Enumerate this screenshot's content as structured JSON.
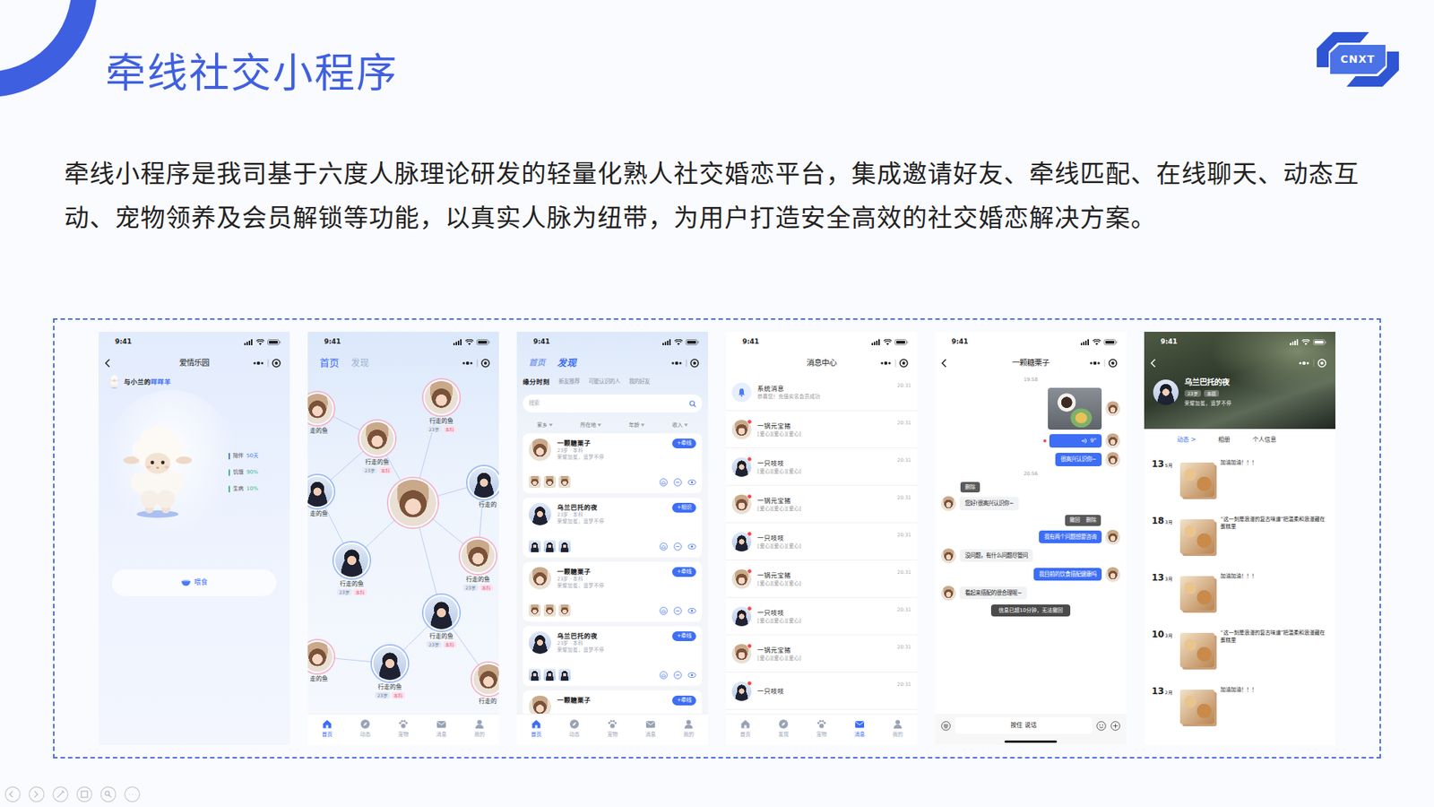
{
  "slide": {
    "title": "牵线社交小程序",
    "description": "牵线小程序是我司基于六度人脉理论研发的轻量化熟人社交婚恋平台，集成邀请好友、牵线匹配、在线聊天、动态互动、宠物领养及会员解锁等功能，以真实人脉为纽带，为用户打造安全高效的社交婚恋解决方案。",
    "logo": "CNXT"
  },
  "pet_screen": {
    "time": "9:41",
    "title": "爱情乐园",
    "owner_prefix": "与小兰的",
    "pet_name": "咩咩羊",
    "stats": [
      {
        "label": "陪伴",
        "value": "50天",
        "color": "#4a7bf0"
      },
      {
        "label": "饥饿",
        "value": "90%",
        "color": "#35b5a2"
      },
      {
        "label": "生病",
        "value": "10%",
        "color": "#42b883"
      }
    ],
    "feed_button": "喂食"
  },
  "network_screen": {
    "time": "9:41",
    "tabs": [
      {
        "label": "首页",
        "selected": true
      },
      {
        "label": "发现",
        "selected": false
      }
    ],
    "center_node": {
      "kind": "female"
    },
    "nodes": [
      {
        "name": "行走的鱼",
        "tags": [
          "23岁",
          "本科"
        ],
        "kind": "female"
      },
      {
        "name": "走的鱼",
        "tags": [],
        "kind": "female"
      },
      {
        "name": "行走的鱼",
        "tags": [
          "23岁",
          "本科"
        ],
        "kind": "female"
      },
      {
        "name": "行走的",
        "tags": [],
        "kind": "male"
      },
      {
        "name": "走的鱼",
        "tags": [],
        "kind": "male"
      },
      {
        "name": "行走的鱼",
        "tags": [
          "23岁",
          "本科"
        ],
        "kind": "male"
      },
      {
        "name": "行走的鱼",
        "tags": [
          "23岁",
          "本科"
        ],
        "kind": "female"
      },
      {
        "name": "行走的鱼",
        "tags": [
          "23岁",
          "本科"
        ],
        "kind": "male"
      },
      {
        "name": "走的鱼",
        "tags": [],
        "kind": "female"
      },
      {
        "name": "行走的鱼",
        "tags": [
          "23岁",
          "本科"
        ],
        "kind": "male"
      },
      {
        "name": "行走的",
        "tags": [],
        "kind": "female"
      }
    ],
    "tabbar": [
      {
        "label": "首页",
        "selected": true
      },
      {
        "label": "动态",
        "selected": false
      },
      {
        "label": "宠物",
        "selected": false
      },
      {
        "label": "消息",
        "selected": false
      },
      {
        "label": "我的",
        "selected": false
      }
    ]
  },
  "discover_screen": {
    "time": "9:41",
    "tabs": [
      {
        "label": "首页",
        "selected": false
      },
      {
        "label": "发现",
        "selected": true
      }
    ],
    "subtabs": [
      {
        "label": "缘分时刻",
        "selected": true
      },
      {
        "label": "新友推荐",
        "selected": false
      },
      {
        "label": "可能认识的人",
        "selected": false
      },
      {
        "label": "我的好友",
        "selected": false
      }
    ],
    "search": {
      "placeholder": "搜索"
    },
    "filters": [
      "家乡",
      "所在地",
      "年龄",
      "收入"
    ],
    "cards": [
      {
        "name": "一颗糖栗子",
        "badge": "+牵线",
        "info": "23岁 · 本科",
        "motto": "荣耀加冕，追梦不停",
        "kind": "female"
      },
      {
        "name": "乌兰巴托的夜",
        "badge": "+相识",
        "info": "23岁 · 本科",
        "motto": "荣耀加冕，追梦不停",
        "kind": "male"
      },
      {
        "name": "一颗糖栗子",
        "badge": "+牵线",
        "info": "23岁 · 本科",
        "motto": "荣耀加冕，追梦不停",
        "kind": "female"
      },
      {
        "name": "乌兰巴托的夜",
        "badge": "+牵线",
        "info": "23岁 · 本科",
        "motto": "荣耀加冕，追梦不停",
        "kind": "male"
      },
      {
        "name": "一颗糖栗子",
        "badge": "+牵线",
        "kind": "female"
      }
    ],
    "tabbar": [
      {
        "label": "首页",
        "selected": true
      },
      {
        "label": "动态",
        "selected": false
      },
      {
        "label": "宠物",
        "selected": false
      },
      {
        "label": "消息",
        "selected": false
      },
      {
        "label": "我的",
        "selected": false
      }
    ]
  },
  "messages_screen": {
    "time": "9:41",
    "title": "消息中心",
    "system": {
      "title": "系统消息",
      "time": "20:31",
      "text": "恭喜您！充值实名会员成功"
    },
    "items": [
      {
        "name": "一锅元宝猪",
        "preview": "[爱心][爱心][爱心]",
        "time": "20:31",
        "unread": true,
        "kind": "female"
      },
      {
        "name": "一只吱吱",
        "preview": "[爱心][爱心][爱心]",
        "time": "20:31",
        "unread": true,
        "kind": "male"
      },
      {
        "name": "一锅元宝猪",
        "preview": "[爱心][爱心][爱心]",
        "time": "20:31",
        "unread": true,
        "kind": "female"
      },
      {
        "name": "一只吱吱",
        "preview": "[爱心][爱心][爱心]",
        "time": "20:31",
        "unread": true,
        "kind": "male"
      },
      {
        "name": "一锅元宝猪",
        "preview": "[爱心][爱心][爱心]",
        "time": "20:31",
        "unread": true,
        "kind": "female"
      },
      {
        "name": "一只吱吱",
        "preview": "[爱心][爱心][爱心]",
        "time": "20:31",
        "unread": true,
        "kind": "male"
      },
      {
        "name": "一锅元宝猪",
        "preview": "[爱心][爱心][爱心]",
        "time": "20:31",
        "unread": true,
        "kind": "female"
      },
      {
        "name": "一只吱吱",
        "time": "20:31",
        "unread": true,
        "kind": "male"
      }
    ],
    "tabbar": [
      {
        "label": "首页",
        "selected": false
      },
      {
        "label": "发现",
        "selected": false
      },
      {
        "label": "宠物",
        "selected": false
      },
      {
        "label": "消息",
        "selected": true
      },
      {
        "label": "我的",
        "selected": false
      }
    ]
  },
  "chat_screen": {
    "time": "9:41",
    "title": "一颗糖栗子",
    "messages": [
      {
        "kind": "time",
        "text": "19:58"
      },
      {
        "kind": "image",
        "from": "me"
      },
      {
        "kind": "voice",
        "from": "me",
        "text": "9\"",
        "unread": true
      },
      {
        "kind": "text",
        "from": "me",
        "text": "很高兴认识你~"
      },
      {
        "kind": "time",
        "text": "20:56"
      },
      {
        "kind": "menu",
        "from": "other",
        "items": [
          "删除"
        ]
      },
      {
        "kind": "text",
        "from": "other",
        "text": "您好!很高兴认识你~"
      },
      {
        "kind": "menu",
        "from": "me",
        "items": [
          "撤回",
          "删除"
        ]
      },
      {
        "kind": "text",
        "from": "me",
        "text": "我有两个问题想要咨询"
      },
      {
        "kind": "text",
        "from": "other",
        "text": "没问题，有什么问题尽管问"
      },
      {
        "kind": "text",
        "from": "me",
        "text": "我目前的饮食搭配健康吗"
      },
      {
        "kind": "text",
        "from": "other",
        "text": "看起来搭配的很合理呢~"
      },
      {
        "kind": "toast",
        "text": "信息已超10分钟，无法撤回"
      }
    ],
    "input": "按住 说话"
  },
  "profile_screen": {
    "time": "9:41",
    "name": "乌兰巴托的夜",
    "tags": [
      "23岁",
      "本硕"
    ],
    "motto": "荣耀加冕，追梦不停",
    "tabs": [
      {
        "label": "动态 >",
        "selected": true
      },
      {
        "label": "相册",
        "selected": false
      },
      {
        "label": "个人信息",
        "selected": false
      }
    ],
    "posts": [
      {
        "day": "13",
        "month": "5月",
        "text": "加油加油！！！"
      },
      {
        "day": "18",
        "month": "3月",
        "text": "“这一刻是浪漫的复古味道”把温柔和浪漫藏在蛋糕里"
      },
      {
        "day": "13",
        "month": "3月",
        "text": "加油加油！！！"
      },
      {
        "day": "10",
        "month": "3月",
        "text": "“这一刻是浪漫的复古味道”把温柔和浪漫藏在蛋糕里"
      },
      {
        "day": "13",
        "month": "2月",
        "text": "加油加油！！！"
      }
    ]
  }
}
